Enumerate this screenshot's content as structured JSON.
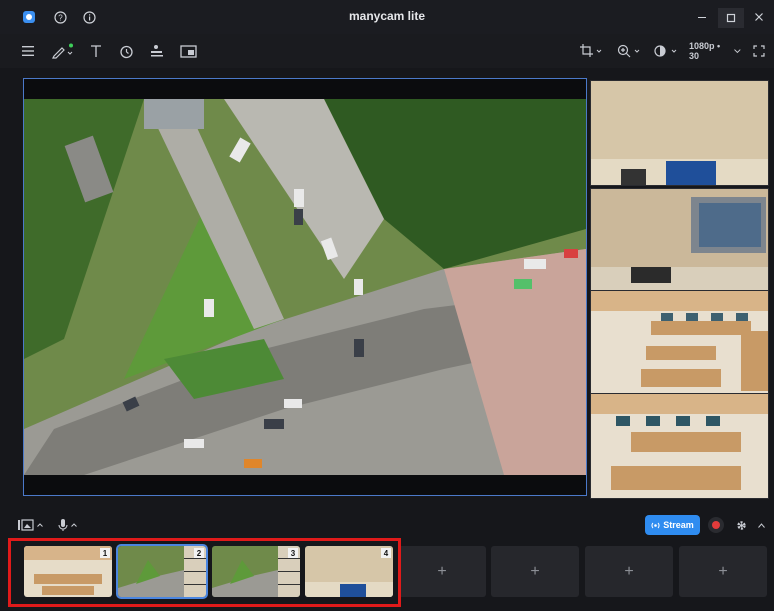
{
  "app": {
    "title": "manycam lite"
  },
  "toolbar": {
    "resolution": "1080p • 30"
  },
  "bottombar": {
    "stream_label": "Stream"
  },
  "presets": [
    {
      "number": "1"
    },
    {
      "number": "2"
    },
    {
      "number": "3"
    },
    {
      "number": "4"
    }
  ],
  "add_slots": [
    "+",
    "+",
    "+",
    "+"
  ],
  "colors": {
    "accent": "#2f8cf0",
    "selection": "#4b86e0",
    "record": "#e23b3b",
    "highlight": "#e01a1a"
  }
}
